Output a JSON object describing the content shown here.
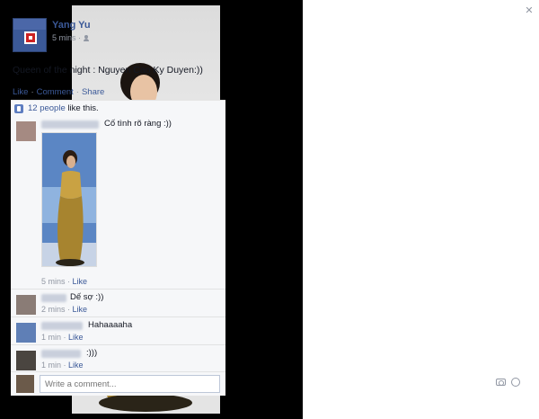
{
  "photo": {
    "description_icon": "photo-of-woman-in-gold-gown"
  },
  "post": {
    "author": "Yang Yu",
    "time": "5 mins ·",
    "privacy_icon": "friends-icon",
    "text": "Queen of the night : Nguyen Cao Ky Duyen:))",
    "actions": {
      "like": "Like",
      "comment": "Comment",
      "share": "Share",
      "sep": "·"
    },
    "likes": {
      "count_link": "12 people",
      "suffix": " like this."
    }
  },
  "comments": [
    {
      "text": "Cố tình rõ ràng :))",
      "time": "5 mins ·",
      "like": "Like"
    },
    {
      "text": "Dế sợ :))",
      "time": "2 mins ·",
      "like": "Like"
    },
    {
      "text": "Hahaaaaha",
      "time": "1 min ·",
      "like": "Like"
    },
    {
      "text": ":)))",
      "time": "1 min ·",
      "like": "Like"
    }
  ],
  "reply": {
    "placeholder": "Write a comment..."
  },
  "close": "✕",
  "colors": {
    "link": "#3b5998",
    "meta": "#9197a3",
    "feedback_bg": "#f6f7f9"
  }
}
